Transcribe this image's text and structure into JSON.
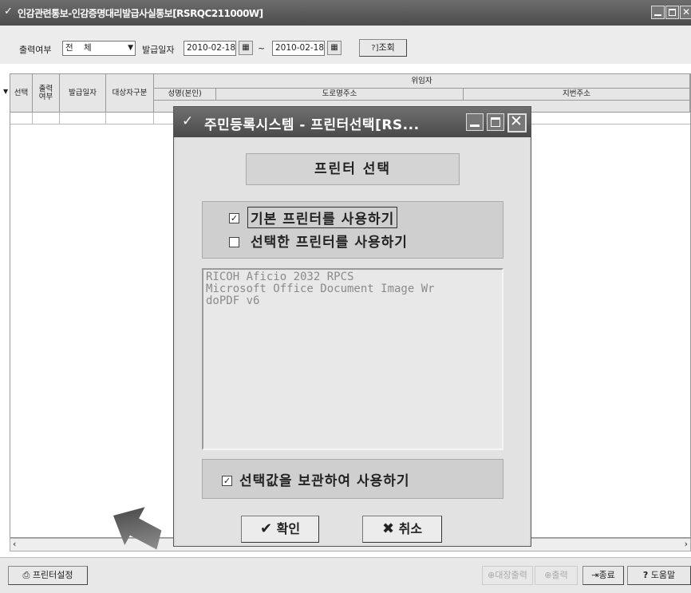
{
  "main_window": {
    "title": "인감관련통보-인감증명대리발급사실통보[RSRQC211000W]"
  },
  "filter": {
    "print_status_label": "출력여부",
    "print_status_value": "전    체",
    "issue_date_label": "발급일자",
    "date_from": "2010-02-18",
    "date_separator": "~",
    "date_to": "2010-02-18",
    "search_label": "조회",
    "search_icon_text": "?]"
  },
  "grid": {
    "columns": {
      "select": "선택",
      "print_status": "출력\n여부",
      "issue_date": "발급일자",
      "target_type": "대상자구분",
      "delegate": "위임자",
      "name": "성명(본인)",
      "road_address": "도로명주소",
      "lot_address": "지번주소"
    }
  },
  "bottom": {
    "printer_settings": "프린터설정",
    "ledger_print": "대장출력",
    "print": "출력",
    "exit": "종료",
    "help": "도움말"
  },
  "dialog": {
    "title": "주민등록시스템 - 프린터선택[RS...",
    "header": "프린터 선택",
    "option_default": "기본 프린터를 사용하기",
    "option_default_checked": true,
    "option_selected": "선택한 프린터를 사용하기",
    "option_selected_checked": false,
    "printers": [
      "RICOH Aficio 2032 RPCS",
      "Microsoft Office Document Image Wr",
      "doPDF v6"
    ],
    "keep_selection": "선택값을 보관하여 사용하기",
    "keep_selection_checked": true,
    "ok": "확인",
    "cancel": "취소"
  }
}
